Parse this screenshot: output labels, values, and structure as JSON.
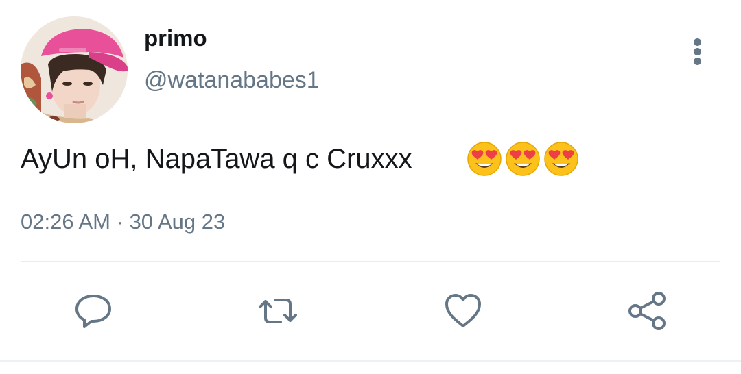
{
  "tweet": {
    "display_name": "primo",
    "handle": "@watanababes1",
    "text": "AyUn oH, NapaTawa q c Cruxxx",
    "emojis": [
      "smiling-face-with-heart-eyes",
      "smiling-face-with-heart-eyes",
      "smiling-face-with-heart-eyes"
    ],
    "time": "02:26 AM",
    "separator": "·",
    "date": "30 Aug 23"
  },
  "actions": {
    "icons": [
      "comment-icon",
      "retweet-icon",
      "heart-icon",
      "share-icon"
    ]
  },
  "colors": {
    "text_primary": "#14171a",
    "text_secondary": "#657786",
    "divider": "#e6ecf0",
    "cap_pink": "#e8509a"
  }
}
